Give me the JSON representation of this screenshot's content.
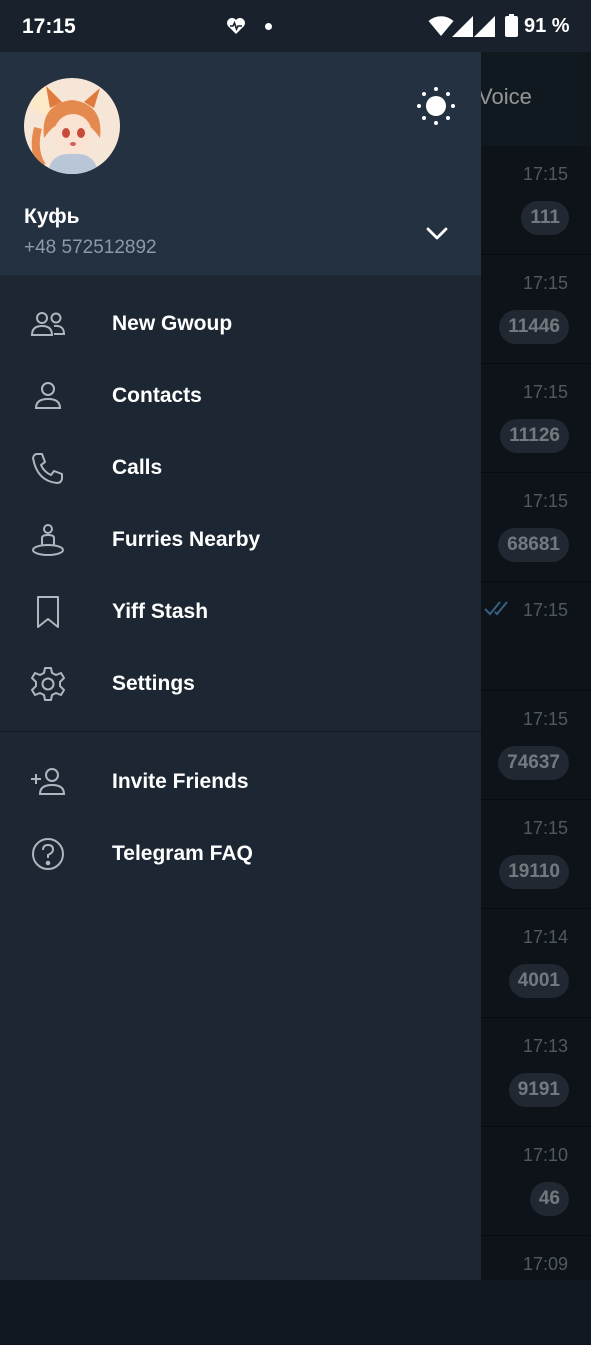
{
  "status_bar": {
    "time": "17:15",
    "battery_percent": "91 %",
    "icons": [
      "heart-health-icon",
      "notification-dot-icon",
      "wifi-icon",
      "cell-signal-icon",
      "cell-signal-icon",
      "battery-icon"
    ]
  },
  "background_chats": {
    "header_title": "Voice",
    "rows": [
      {
        "time": "17:15",
        "badge": "111"
      },
      {
        "time": "17:15",
        "badge": "11446"
      },
      {
        "time": "17:15",
        "badge": "11126"
      },
      {
        "time": "17:15",
        "badge": "68681"
      },
      {
        "time": "17:15",
        "badge": "",
        "read_check": true
      },
      {
        "time": "17:15",
        "badge": "74637"
      },
      {
        "time": "17:15",
        "badge": "19110"
      },
      {
        "time": "17:14",
        "badge": "4001"
      },
      {
        "time": "17:13",
        "badge": "9191"
      },
      {
        "time": "17:10",
        "badge": "46"
      },
      {
        "time": "17:09",
        "badge": ""
      }
    ]
  },
  "drawer": {
    "profile": {
      "name": "Куфь",
      "phone": "+48 572512892"
    },
    "icons": {
      "theme": "sun-icon",
      "account_toggle": "chevron-down-icon"
    },
    "menu": [
      {
        "label": "New Gwoup",
        "icon": "group-icon"
      },
      {
        "label": "Contacts",
        "icon": "person-icon"
      },
      {
        "label": "Calls",
        "icon": "phone-icon"
      },
      {
        "label": "Furries Nearby",
        "icon": "people-nearby-icon"
      },
      {
        "label": "Yiff Stash",
        "icon": "bookmark-icon"
      },
      {
        "label": "Settings",
        "icon": "gear-icon"
      }
    ],
    "menu2": [
      {
        "label": "Invite Friends",
        "icon": "add-user-icon"
      },
      {
        "label": "Telegram FAQ",
        "icon": "help-icon"
      }
    ]
  },
  "colors": {
    "drawer_bg": "#1d2733",
    "drawer_header_bg": "#243140",
    "icon": "#aeb7c0",
    "secondary_text": "#8c9aa8"
  }
}
